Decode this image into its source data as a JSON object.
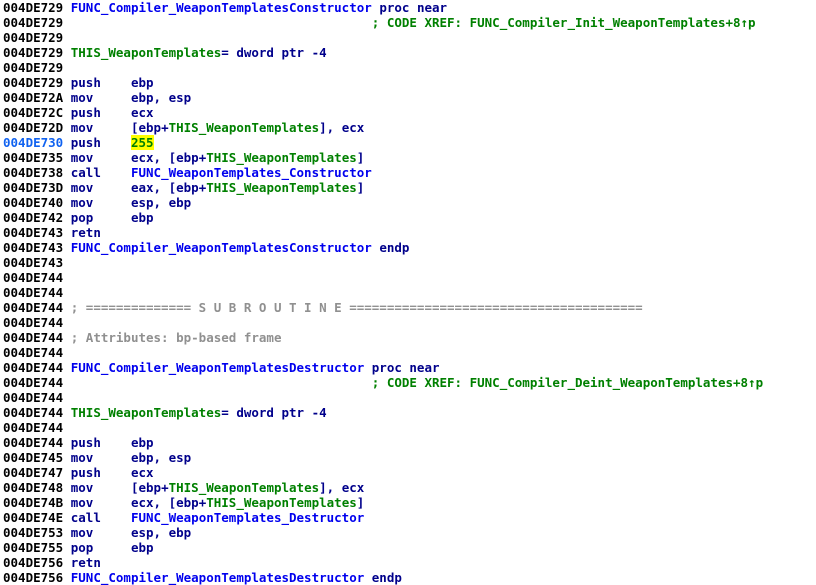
{
  "view": {
    "app": "IDA Pro",
    "panel_name": "IDA View-A",
    "background_color": "#ffffff",
    "colors": {
      "address": "#000000",
      "address_current": "#1062f0",
      "mnemonic": "#00008b",
      "function_name": "#0000ee",
      "local_variable": "#008000",
      "comment": "#008000",
      "divider": "#909090",
      "highlight_background": "#ffff00"
    }
  },
  "lines": [
    {
      "address": "004DE729",
      "current": false,
      "segments": [
        {
          "text": "FUNC_Compiler_WeaponTemplatesConstructor",
          "cls": "seg-name"
        },
        {
          "text": " ",
          "cls": "seg-plain"
        },
        {
          "text": "proc near",
          "cls": "seg-keyword"
        }
      ]
    },
    {
      "address": "004DE729",
      "current": false,
      "segments": [
        {
          "text": "                                        ; CODE XREF: FUNC_Compiler_Init_WeaponTemplates+8↑p",
          "cls": "seg-comment"
        }
      ]
    },
    {
      "address": "004DE729",
      "current": false,
      "segments": []
    },
    {
      "address": "004DE729",
      "current": false,
      "segments": [
        {
          "text": "THIS_WeaponTemplates",
          "cls": "seg-localvar"
        },
        {
          "text": "= dword ptr -4",
          "cls": "seg-keyword"
        }
      ]
    },
    {
      "address": "004DE729",
      "current": false,
      "segments": []
    },
    {
      "address": "004DE729",
      "current": false,
      "segments": [
        {
          "text": "push    ",
          "cls": "seg-mnem"
        },
        {
          "text": "ebp",
          "cls": "seg-reg"
        }
      ]
    },
    {
      "address": "004DE72A",
      "current": false,
      "segments": [
        {
          "text": "mov     ",
          "cls": "seg-mnem"
        },
        {
          "text": "ebp, esp",
          "cls": "seg-reg"
        }
      ]
    },
    {
      "address": "004DE72C",
      "current": false,
      "segments": [
        {
          "text": "push    ",
          "cls": "seg-mnem"
        },
        {
          "text": "ecx",
          "cls": "seg-reg"
        }
      ]
    },
    {
      "address": "004DE72D",
      "current": false,
      "segments": [
        {
          "text": "mov     ",
          "cls": "seg-mnem"
        },
        {
          "text": "[ebp+",
          "cls": "seg-reg"
        },
        {
          "text": "THIS_WeaponTemplates",
          "cls": "seg-localvar"
        },
        {
          "text": "], ecx",
          "cls": "seg-reg"
        }
      ]
    },
    {
      "address": "004DE730",
      "current": true,
      "segments": [
        {
          "text": "push    ",
          "cls": "seg-mnem"
        },
        {
          "text": "",
          "cls": "cursor"
        },
        {
          "text": "255",
          "cls": "seg-highlight"
        }
      ]
    },
    {
      "address": "004DE735",
      "current": false,
      "segments": [
        {
          "text": "mov     ",
          "cls": "seg-mnem"
        },
        {
          "text": "ecx, [ebp+",
          "cls": "seg-reg"
        },
        {
          "text": "THIS_WeaponTemplates",
          "cls": "seg-localvar"
        },
        {
          "text": "]",
          "cls": "seg-reg"
        }
      ]
    },
    {
      "address": "004DE738",
      "current": false,
      "segments": [
        {
          "text": "call    ",
          "cls": "seg-mnem"
        },
        {
          "text": "FUNC_WeaponTemplates_Constructor",
          "cls": "seg-name"
        }
      ]
    },
    {
      "address": "004DE73D",
      "current": false,
      "segments": [
        {
          "text": "mov     ",
          "cls": "seg-mnem"
        },
        {
          "text": "eax, [ebp+",
          "cls": "seg-reg"
        },
        {
          "text": "THIS_WeaponTemplates",
          "cls": "seg-localvar"
        },
        {
          "text": "]",
          "cls": "seg-reg"
        }
      ]
    },
    {
      "address": "004DE740",
      "current": false,
      "segments": [
        {
          "text": "mov     ",
          "cls": "seg-mnem"
        },
        {
          "text": "esp, ebp",
          "cls": "seg-reg"
        }
      ]
    },
    {
      "address": "004DE742",
      "current": false,
      "segments": [
        {
          "text": "pop     ",
          "cls": "seg-mnem"
        },
        {
          "text": "ebp",
          "cls": "seg-reg"
        }
      ]
    },
    {
      "address": "004DE743",
      "current": false,
      "segments": [
        {
          "text": "retn",
          "cls": "seg-mnem"
        }
      ]
    },
    {
      "address": "004DE743",
      "current": false,
      "segments": [
        {
          "text": "FUNC_Compiler_WeaponTemplatesConstructor",
          "cls": "seg-name"
        },
        {
          "text": " ",
          "cls": "seg-plain"
        },
        {
          "text": "endp",
          "cls": "seg-keyword"
        }
      ]
    },
    {
      "address": "004DE743",
      "current": false,
      "segments": []
    },
    {
      "address": "004DE744",
      "current": false,
      "segments": []
    },
    {
      "address": "004DE744",
      "current": false,
      "segments": []
    },
    {
      "address": "004DE744",
      "current": false,
      "segments": [
        {
          "text": "; ============== S U B R O U T I N E =======================================",
          "cls": "seg-divider"
        }
      ]
    },
    {
      "address": "004DE744",
      "current": false,
      "segments": []
    },
    {
      "address": "004DE744",
      "current": false,
      "segments": [
        {
          "text": "; Attributes: bp-based frame",
          "cls": "seg-attr"
        }
      ]
    },
    {
      "address": "004DE744",
      "current": false,
      "segments": []
    },
    {
      "address": "004DE744",
      "current": false,
      "segments": [
        {
          "text": "FUNC_Compiler_WeaponTemplatesDestructor",
          "cls": "seg-name"
        },
        {
          "text": " ",
          "cls": "seg-plain"
        },
        {
          "text": "proc near",
          "cls": "seg-keyword"
        }
      ]
    },
    {
      "address": "004DE744",
      "current": false,
      "segments": [
        {
          "text": "                                        ; CODE XREF: FUNC_Compiler_Deint_WeaponTemplates+8↑p",
          "cls": "seg-comment"
        }
      ]
    },
    {
      "address": "004DE744",
      "current": false,
      "segments": []
    },
    {
      "address": "004DE744",
      "current": false,
      "segments": [
        {
          "text": "THIS_WeaponTemplates",
          "cls": "seg-localvar"
        },
        {
          "text": "= dword ptr -4",
          "cls": "seg-keyword"
        }
      ]
    },
    {
      "address": "004DE744",
      "current": false,
      "segments": []
    },
    {
      "address": "004DE744",
      "current": false,
      "segments": [
        {
          "text": "push    ",
          "cls": "seg-mnem"
        },
        {
          "text": "ebp",
          "cls": "seg-reg"
        }
      ]
    },
    {
      "address": "004DE745",
      "current": false,
      "segments": [
        {
          "text": "mov     ",
          "cls": "seg-mnem"
        },
        {
          "text": "ebp, esp",
          "cls": "seg-reg"
        }
      ]
    },
    {
      "address": "004DE747",
      "current": false,
      "segments": [
        {
          "text": "push    ",
          "cls": "seg-mnem"
        },
        {
          "text": "ecx",
          "cls": "seg-reg"
        }
      ]
    },
    {
      "address": "004DE748",
      "current": false,
      "segments": [
        {
          "text": "mov     ",
          "cls": "seg-mnem"
        },
        {
          "text": "[ebp+",
          "cls": "seg-reg"
        },
        {
          "text": "THIS_WeaponTemplates",
          "cls": "seg-localvar"
        },
        {
          "text": "], ecx",
          "cls": "seg-reg"
        }
      ]
    },
    {
      "address": "004DE74B",
      "current": false,
      "segments": [
        {
          "text": "mov     ",
          "cls": "seg-mnem"
        },
        {
          "text": "ecx, [ebp+",
          "cls": "seg-reg"
        },
        {
          "text": "THIS_WeaponTemplates",
          "cls": "seg-localvar"
        },
        {
          "text": "]",
          "cls": "seg-reg"
        }
      ]
    },
    {
      "address": "004DE74E",
      "current": false,
      "segments": [
        {
          "text": "call    ",
          "cls": "seg-mnem"
        },
        {
          "text": "FUNC_WeaponTemplates_Destructor",
          "cls": "seg-name"
        }
      ]
    },
    {
      "address": "004DE753",
      "current": false,
      "segments": [
        {
          "text": "mov     ",
          "cls": "seg-mnem"
        },
        {
          "text": "esp, ebp",
          "cls": "seg-reg"
        }
      ]
    },
    {
      "address": "004DE755",
      "current": false,
      "segments": [
        {
          "text": "pop     ",
          "cls": "seg-mnem"
        },
        {
          "text": "ebp",
          "cls": "seg-reg"
        }
      ]
    },
    {
      "address": "004DE756",
      "current": false,
      "segments": [
        {
          "text": "retn",
          "cls": "seg-mnem"
        }
      ]
    },
    {
      "address": "004DE756",
      "current": false,
      "segments": [
        {
          "text": "FUNC_Compiler_WeaponTemplatesDestructor",
          "cls": "seg-name"
        },
        {
          "text": " ",
          "cls": "seg-plain"
        },
        {
          "text": "endp",
          "cls": "seg-keyword"
        }
      ]
    }
  ]
}
